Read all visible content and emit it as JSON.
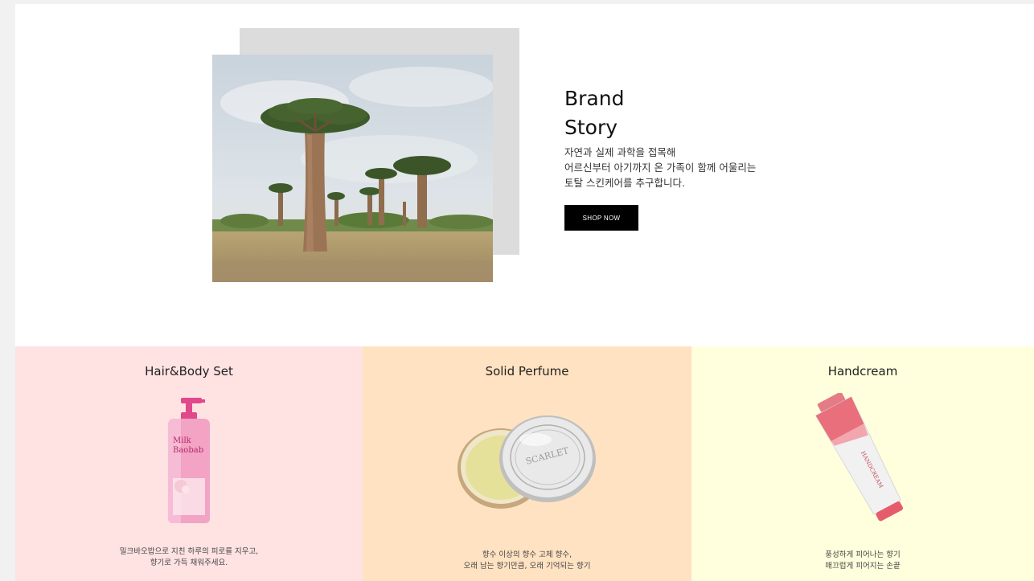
{
  "brand_story": {
    "title_line1": "Brand",
    "title_line2": "Story",
    "desc_lines": [
      "자연과 실제 과학을 접목해",
      "어르신부터 아기까지 온 가족이 함께 어울리는",
      "토탈 스킨케어를 추구합니다."
    ],
    "shop_button": "SHOP NOW"
  },
  "categories": [
    {
      "title": "Hair&Body Set",
      "bottle_text1": "Milk",
      "bottle_text2": "Baobab",
      "desc_lines": [
        "밀크바오밥으로 지친 하루의 피로를 지우고,",
        "향기로 가득 채워주세요."
      ],
      "color": "#ffe2e2"
    },
    {
      "title": "Solid Perfume",
      "lid_text": "SCARLET",
      "desc_lines": [
        "향수 이상의 향수 고체 향수,",
        "오래 남는 향기만큼, 오래 기억되는 향기"
      ],
      "color": "#ffe2c2"
    },
    {
      "title": "Handcream",
      "tube_text": "HANDCREAM",
      "desc_lines": [
        "풍성하게 피어나는 향기",
        "매끄럽게 피어지는 손끝"
      ],
      "color": "#ffffdd"
    }
  ]
}
